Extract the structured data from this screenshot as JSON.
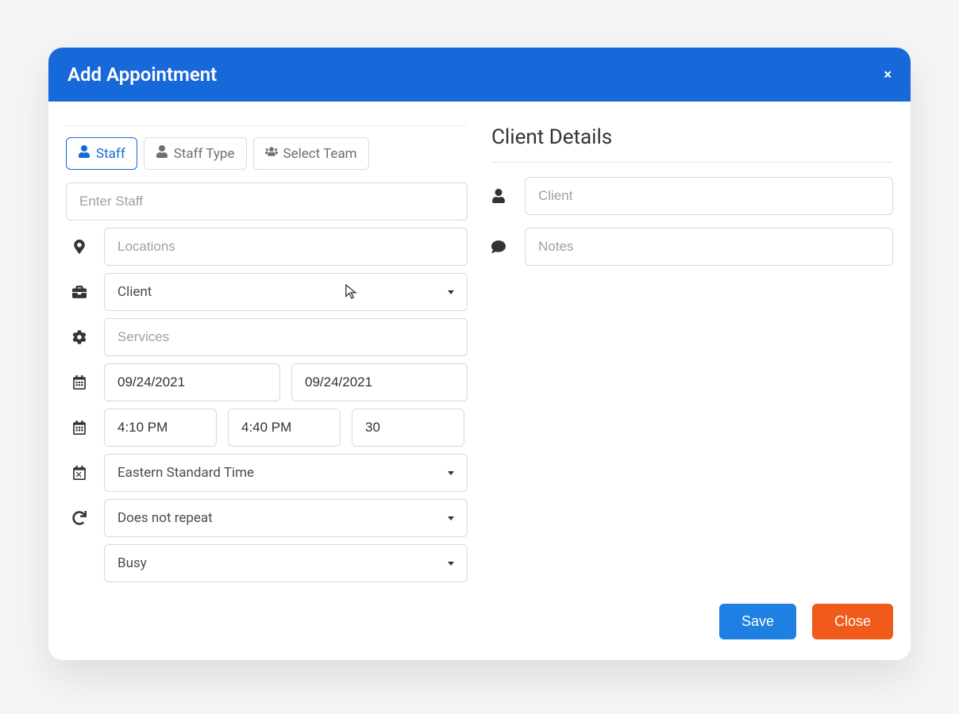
{
  "modal": {
    "title": "Add Appointment",
    "close_symbol": "×"
  },
  "tabs": {
    "staff": "Staff",
    "staff_type": "Staff Type",
    "select_team": "Select Team"
  },
  "left": {
    "enter_staff_placeholder": "Enter Staff",
    "locations_placeholder": "Locations",
    "client_select": "Client",
    "services_placeholder": "Services",
    "start_date": "09/24/2021",
    "end_date": "09/24/2021",
    "start_time": "4:10 PM",
    "end_time": "4:40 PM",
    "duration": "30",
    "timezone": "Eastern Standard Time",
    "repeat": "Does not repeat",
    "availability": "Busy"
  },
  "right": {
    "heading": "Client Details",
    "client_placeholder": "Client",
    "notes_placeholder": "Notes"
  },
  "footer": {
    "save": "Save",
    "close": "Close"
  }
}
